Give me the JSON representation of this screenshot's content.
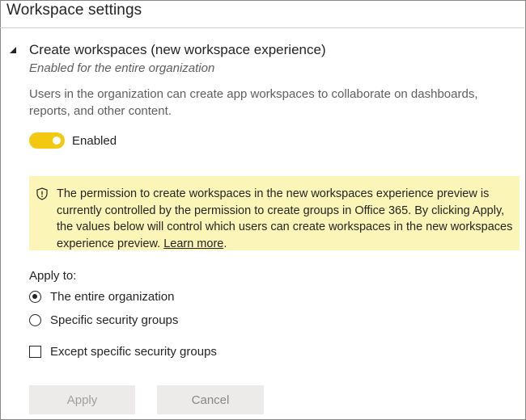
{
  "page": {
    "title": "Workspace settings"
  },
  "section": {
    "title": "Create workspaces (new workspace experience)",
    "subtitle": "Enabled for the entire organization",
    "description": "Users in the organization can create app workspaces to collaborate on dashboards, reports, and other content."
  },
  "toggle": {
    "state": "on",
    "label": "Enabled",
    "color": "#f2c811"
  },
  "warning": {
    "icon": "shield-warning-icon",
    "text": "The permission to create workspaces in the new workspaces experience preview is currently controlled by the permission to create groups in Office 365. By clicking Apply, the values below will control which users can create workspaces in the new workspaces experience preview. ",
    "link_text": "Learn more",
    "trailing": ".",
    "background": "#fbf6b7"
  },
  "apply_to": {
    "label": "Apply to:",
    "options": [
      {
        "label": "The entire organization",
        "selected": true
      },
      {
        "label": "Specific security groups",
        "selected": false
      }
    ]
  },
  "except": {
    "label": "Except specific security groups",
    "checked": false
  },
  "buttons": {
    "apply_label": "Apply",
    "cancel_label": "Cancel"
  }
}
